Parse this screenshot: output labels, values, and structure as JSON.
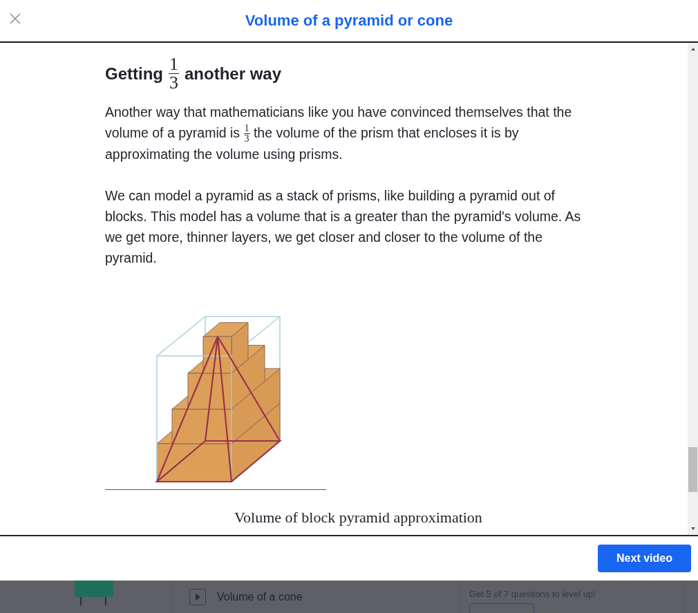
{
  "header": {
    "title": "Volume of a pyramid or cone"
  },
  "article": {
    "heading": {
      "before": "Getting",
      "fraction": {
        "numerator": "1",
        "denominator": "3"
      },
      "after": "another way"
    },
    "paragraphs": [
      {
        "before": "Another way that mathematicians like you have convinced themselves that the volume of a pyramid is",
        "fraction": {
          "numerator": "1",
          "denominator": "3"
        },
        "after": "the volume of the prism that encloses it is by approximating the volume using prisms."
      },
      {
        "before": "We can model a pyramid as a stack of prisms, like building a pyramid out of blocks. This model has a volume that is a greater than the pyramid's volume. As we get more, thinner layers, we get closer and closer to the volume of the pyramid."
      }
    ],
    "figure": {
      "caption": "Volume of block pyramid approximation"
    }
  },
  "footer": {
    "button": "Next video"
  },
  "background": {
    "lesson": "Volume of a cone",
    "progress": "Get 5 of 7 questions to level up!"
  }
}
